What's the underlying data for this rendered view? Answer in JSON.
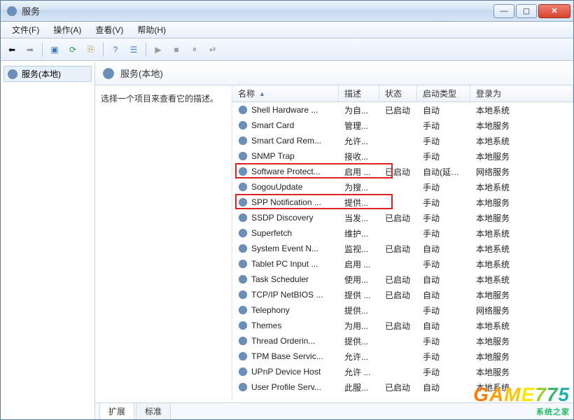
{
  "title": "服务",
  "menus": {
    "file": "文件(F)",
    "action": "操作(A)",
    "view": "查看(V)",
    "help": "帮助(H)"
  },
  "tree": {
    "root": "服务(本地)"
  },
  "header": {
    "title": "服务(本地)"
  },
  "desc": {
    "prompt": "选择一个项目来查看它的描述。"
  },
  "columns": {
    "name": "名称",
    "desc": "描述",
    "status": "状态",
    "startup": "启动类型",
    "logon": "登录为"
  },
  "tabs": {
    "ext": "扩展",
    "std": "标准"
  },
  "rows": [
    {
      "name": "Shell Hardware ...",
      "desc": "为自...",
      "status": "已启动",
      "startup": "自动",
      "logon": "本地系统"
    },
    {
      "name": "Smart Card",
      "desc": "管理...",
      "status": "",
      "startup": "手动",
      "logon": "本地服务"
    },
    {
      "name": "Smart Card Rem...",
      "desc": "允许...",
      "status": "",
      "startup": "手动",
      "logon": "本地系统"
    },
    {
      "name": "SNMP Trap",
      "desc": "接收...",
      "status": "",
      "startup": "手动",
      "logon": "本地服务"
    },
    {
      "name": "Software Protect...",
      "desc": "启用 ...",
      "status": "已启动",
      "startup": "自动(延迟...",
      "logon": "网络服务"
    },
    {
      "name": "SogouUpdate",
      "desc": "为搜...",
      "status": "",
      "startup": "手动",
      "logon": "本地系统"
    },
    {
      "name": "SPP Notification ...",
      "desc": "提供...",
      "status": "",
      "startup": "手动",
      "logon": "本地服务"
    },
    {
      "name": "SSDP Discovery",
      "desc": "当发...",
      "status": "已启动",
      "startup": "手动",
      "logon": "本地服务"
    },
    {
      "name": "Superfetch",
      "desc": "维护...",
      "status": "",
      "startup": "手动",
      "logon": "本地系统"
    },
    {
      "name": "System Event N...",
      "desc": "监视...",
      "status": "已启动",
      "startup": "自动",
      "logon": "本地系统"
    },
    {
      "name": "Tablet PC Input ...",
      "desc": "启用 ...",
      "status": "",
      "startup": "手动",
      "logon": "本地系统"
    },
    {
      "name": "Task Scheduler",
      "desc": "使用...",
      "status": "已启动",
      "startup": "自动",
      "logon": "本地系统"
    },
    {
      "name": "TCP/IP NetBIOS ...",
      "desc": "提供 ...",
      "status": "已启动",
      "startup": "自动",
      "logon": "本地服务"
    },
    {
      "name": "Telephony",
      "desc": "提供...",
      "status": "",
      "startup": "手动",
      "logon": "网络服务"
    },
    {
      "name": "Themes",
      "desc": "为用...",
      "status": "已启动",
      "startup": "自动",
      "logon": "本地系统"
    },
    {
      "name": "Thread Orderin...",
      "desc": "提供...",
      "status": "",
      "startup": "手动",
      "logon": "本地服务"
    },
    {
      "name": "TPM Base Servic...",
      "desc": "允许...",
      "status": "",
      "startup": "手动",
      "logon": "本地服务"
    },
    {
      "name": "UPnP Device Host",
      "desc": "允许 ...",
      "status": "",
      "startup": "手动",
      "logon": "本地服务"
    },
    {
      "name": "User Profile Serv...",
      "desc": "此服...",
      "status": "已启动",
      "startup": "自动",
      "logon": "本地系统"
    }
  ],
  "watermark": {
    "text": "GAME775",
    "sub": "系统之家"
  }
}
